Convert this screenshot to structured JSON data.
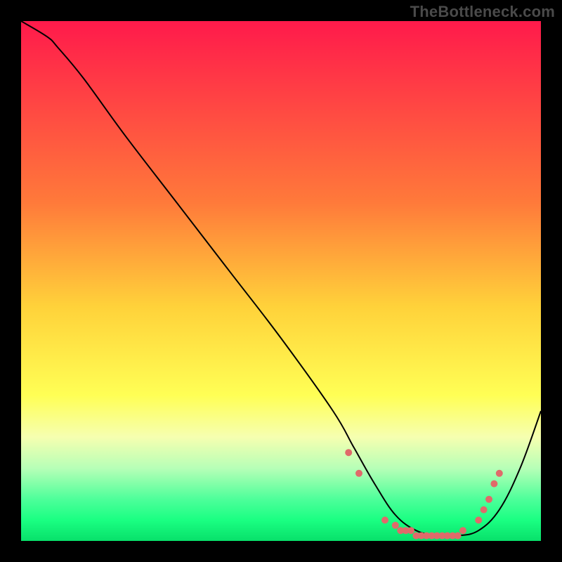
{
  "watermark": "TheBottleneck.com",
  "chart_data": {
    "type": "line",
    "title": "",
    "xlabel": "",
    "ylabel": "",
    "xlim": [
      0,
      100
    ],
    "ylim": [
      0,
      100
    ],
    "legend": false,
    "grid": false,
    "background": {
      "description": "vertical red→yellow→green gradient, green band at bottom",
      "stops": [
        {
          "pos": 0.0,
          "color": "#ff1a4b"
        },
        {
          "pos": 0.35,
          "color": "#ff7a3a"
        },
        {
          "pos": 0.55,
          "color": "#ffd23a"
        },
        {
          "pos": 0.72,
          "color": "#ffff55"
        },
        {
          "pos": 0.8,
          "color": "#f6ffb0"
        },
        {
          "pos": 0.86,
          "color": "#b7ffb7"
        },
        {
          "pos": 0.92,
          "color": "#4dff9a"
        },
        {
          "pos": 0.96,
          "color": "#1aff82"
        },
        {
          "pos": 1.0,
          "color": "#08e06a"
        }
      ]
    },
    "series": [
      {
        "name": "bottleneck-curve",
        "color": "#000000",
        "x": [
          0,
          5,
          7,
          12,
          20,
          30,
          40,
          50,
          60,
          64,
          68,
          72,
          76,
          80,
          84,
          88,
          92,
          96,
          100
        ],
        "y": [
          100,
          97,
          95,
          89,
          78,
          65,
          52,
          39,
          25,
          18,
          11,
          5,
          2,
          1,
          1,
          2,
          6,
          14,
          25
        ]
      }
    ],
    "markers": {
      "name": "highlight-dots",
      "color": "#e06a6a",
      "points": [
        {
          "x": 63,
          "y": 17
        },
        {
          "x": 65,
          "y": 13
        },
        {
          "x": 70,
          "y": 4
        },
        {
          "x": 72,
          "y": 3
        },
        {
          "x": 73,
          "y": 2
        },
        {
          "x": 74,
          "y": 2
        },
        {
          "x": 75,
          "y": 2
        },
        {
          "x": 76,
          "y": 1
        },
        {
          "x": 77,
          "y": 1
        },
        {
          "x": 78,
          "y": 1
        },
        {
          "x": 79,
          "y": 1
        },
        {
          "x": 80,
          "y": 1
        },
        {
          "x": 81,
          "y": 1
        },
        {
          "x": 82,
          "y": 1
        },
        {
          "x": 83,
          "y": 1
        },
        {
          "x": 84,
          "y": 1
        },
        {
          "x": 85,
          "y": 2
        },
        {
          "x": 88,
          "y": 4
        },
        {
          "x": 89,
          "y": 6
        },
        {
          "x": 90,
          "y": 8
        },
        {
          "x": 91,
          "y": 11
        },
        {
          "x": 92,
          "y": 13
        }
      ]
    }
  }
}
